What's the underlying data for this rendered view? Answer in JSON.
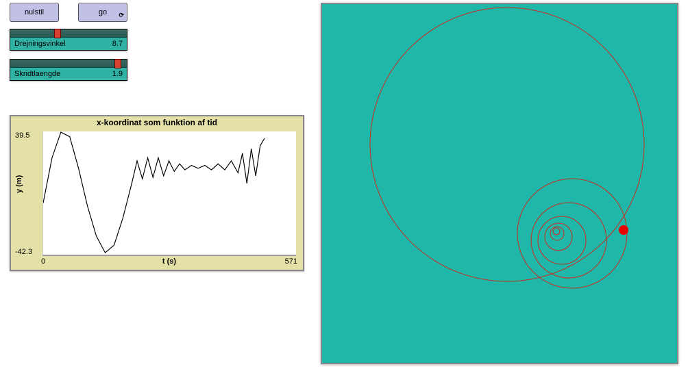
{
  "buttons": {
    "reset": "nulstil",
    "go": "go"
  },
  "sliders": {
    "angle": {
      "label": "Drejningsvinkel",
      "value": "8.7",
      "pos": 0.4
    },
    "step": {
      "label": "Skridtlaengde",
      "value": "1.9",
      "pos": 0.95
    }
  },
  "plot": {
    "title": "x-koordinat som funktion af tid",
    "ylabel": "y (m)",
    "xlabel": "t (s)",
    "ymax": "39.5",
    "ymin": "-42.3",
    "xmin": "0",
    "xmax": "571"
  },
  "chart_data": {
    "type": "line",
    "title": "x-koordinat som funktion af tid",
    "xlabel": "t (s)",
    "ylabel": "y (m)",
    "xlim": [
      0,
      571
    ],
    "ylim": [
      -42.3,
      39.5
    ],
    "x": [
      0,
      20,
      40,
      60,
      80,
      100,
      120,
      140,
      160,
      180,
      200,
      212,
      224,
      236,
      248,
      260,
      272,
      284,
      296,
      308,
      320,
      335,
      350,
      365,
      380,
      395,
      410,
      425,
      440,
      450,
      460,
      470,
      480,
      490,
      500
    ],
    "values": [
      -8,
      22,
      39,
      36,
      15,
      -10,
      -30,
      -41,
      -36,
      -18,
      5,
      20,
      8,
      22,
      9,
      22,
      10,
      20,
      13,
      18,
      14,
      17,
      15,
      17,
      14,
      18,
      14,
      20,
      12,
      25,
      5,
      28,
      10,
      30,
      35
    ]
  },
  "world": {
    "agent_pos": [
      440,
      330
    ]
  }
}
